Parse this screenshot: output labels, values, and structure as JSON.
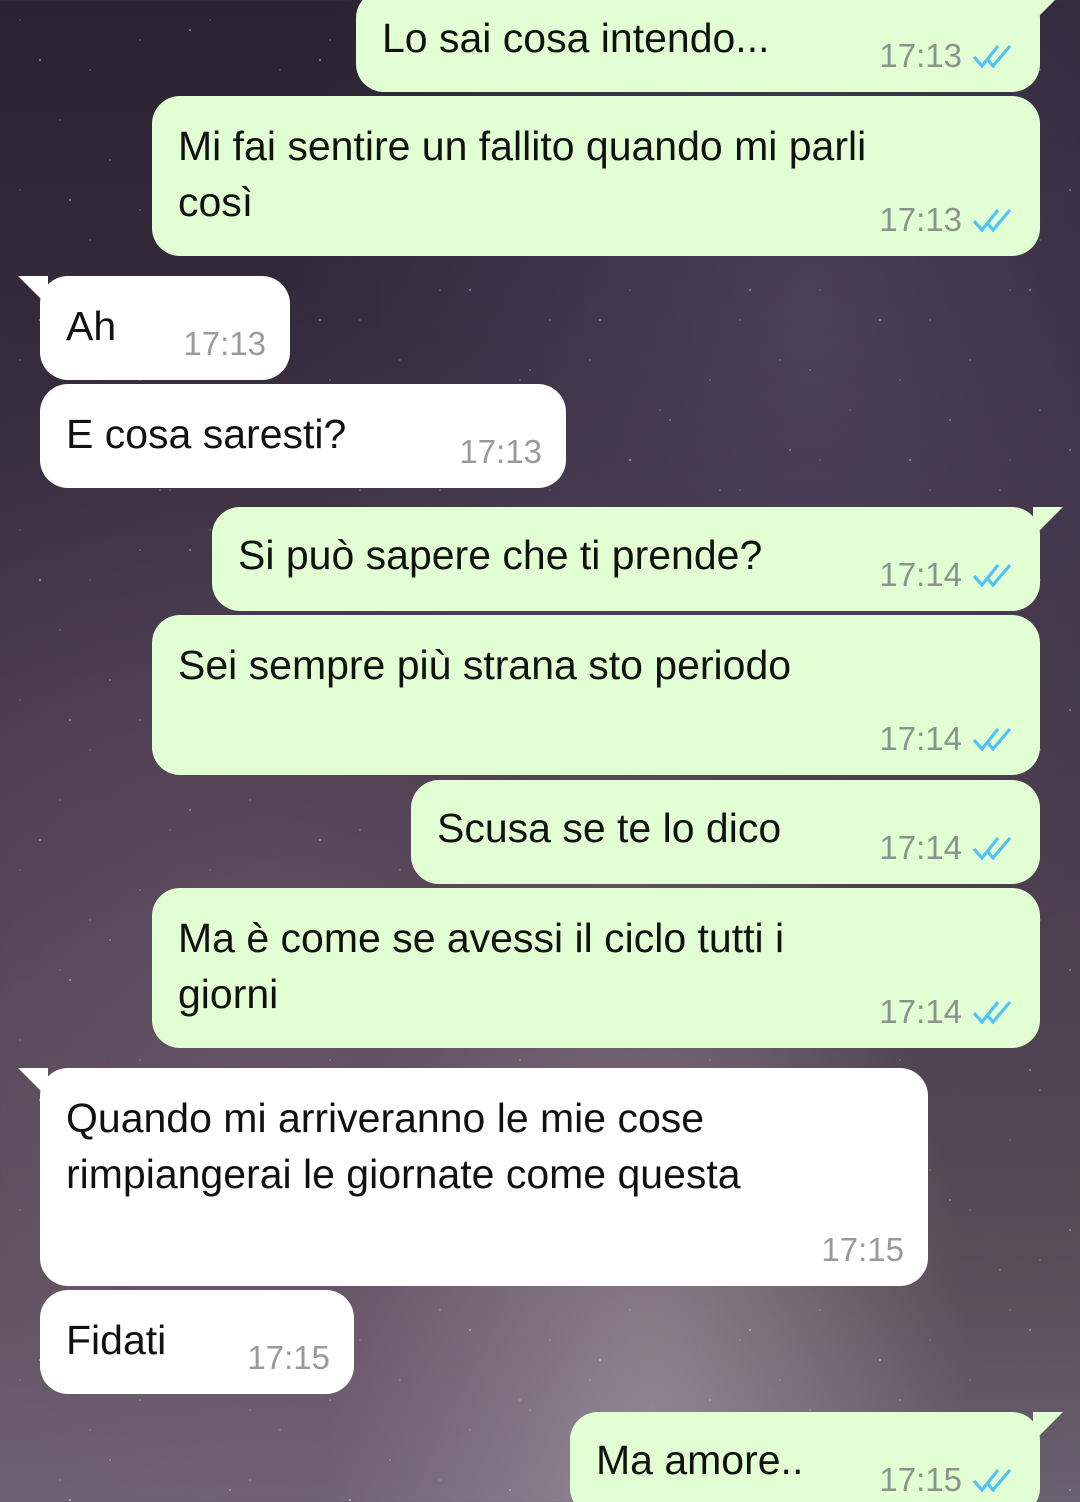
{
  "theme": {
    "outgoing_bubble": "#e2ffd4",
    "incoming_bubble": "#ffffff",
    "read_tick_color": "#4fc3f7",
    "timestamp_color": "#8a948c"
  },
  "messages": [
    {
      "direction": "outgoing",
      "text": "Lo sai cosa intendo...",
      "time": "17:13",
      "status": "read"
    },
    {
      "direction": "outgoing",
      "text": "Mi fai sentire un fallito quando mi parli\ncosì",
      "time": "17:13",
      "status": "read"
    },
    {
      "direction": "incoming",
      "text": "Ah",
      "time": "17:13"
    },
    {
      "direction": "incoming",
      "text": "E cosa saresti?",
      "time": "17:13"
    },
    {
      "direction": "outgoing",
      "text": "Si può sapere che ti prende?",
      "time": "17:14",
      "status": "read"
    },
    {
      "direction": "outgoing",
      "text": "Sei sempre più strana sto periodo",
      "time": "17:14",
      "status": "read"
    },
    {
      "direction": "outgoing",
      "text": "Scusa se te lo dico",
      "time": "17:14",
      "status": "read"
    },
    {
      "direction": "outgoing",
      "text": "Ma è come se avessi il ciclo tutti i\ngiorni",
      "time": "17:14",
      "status": "read"
    },
    {
      "direction": "incoming",
      "text": "Quando mi arriveranno le mie cose\nrimpiangerai le giornate come questa",
      "time": "17:15"
    },
    {
      "direction": "incoming",
      "text": "Fidati",
      "time": "17:15"
    },
    {
      "direction": "outgoing",
      "text": "Ma amore..",
      "time": "17:15",
      "status": "read"
    }
  ]
}
